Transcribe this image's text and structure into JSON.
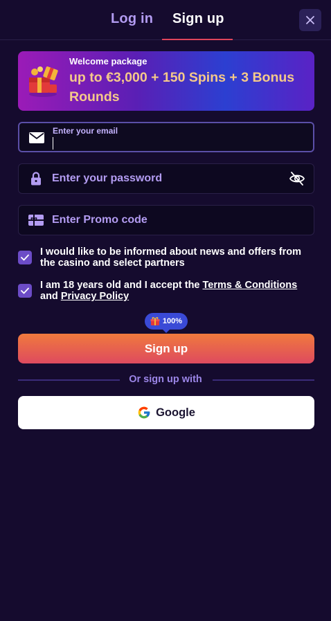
{
  "tabs": {
    "login": "Log in",
    "signup": "Sign up",
    "active": "signup"
  },
  "banner": {
    "kicker": "Welcome package",
    "title": "up to €3,000 + 150 Spins + 3 Bonus Rounds"
  },
  "form": {
    "email": {
      "label": "Enter your email",
      "value": "",
      "icon": "mail-icon"
    },
    "password": {
      "placeholder": "Enter your password",
      "icon": "lock-icon",
      "toggle_icon": "eye-off-icon"
    },
    "promo": {
      "placeholder": "Enter Promo code",
      "icon": "gift-card-icon"
    }
  },
  "consents": {
    "news": {
      "checked": true,
      "text": "I would like to be informed about news and offers from the casino and select partners"
    },
    "age": {
      "checked": true,
      "text_before": "I am 18 years old and I accept the ",
      "terms_link": "Terms & Conditions",
      "text_and": "and",
      "privacy_link": "Privacy Policy"
    }
  },
  "badge": {
    "value": "100%",
    "icon": "gift-icon"
  },
  "signup_button": "Sign up",
  "divider": "Or sign up with",
  "google_button": "Google",
  "colors": {
    "background": "#150b2e",
    "accent": "#b39cf2",
    "tab_underline": "#e0455b",
    "button_gradient_top": "#f07a3d",
    "button_gradient_bottom": "#de4a5f",
    "checkbox": "#6c4cc7",
    "banner_title": "#f5c98a"
  }
}
